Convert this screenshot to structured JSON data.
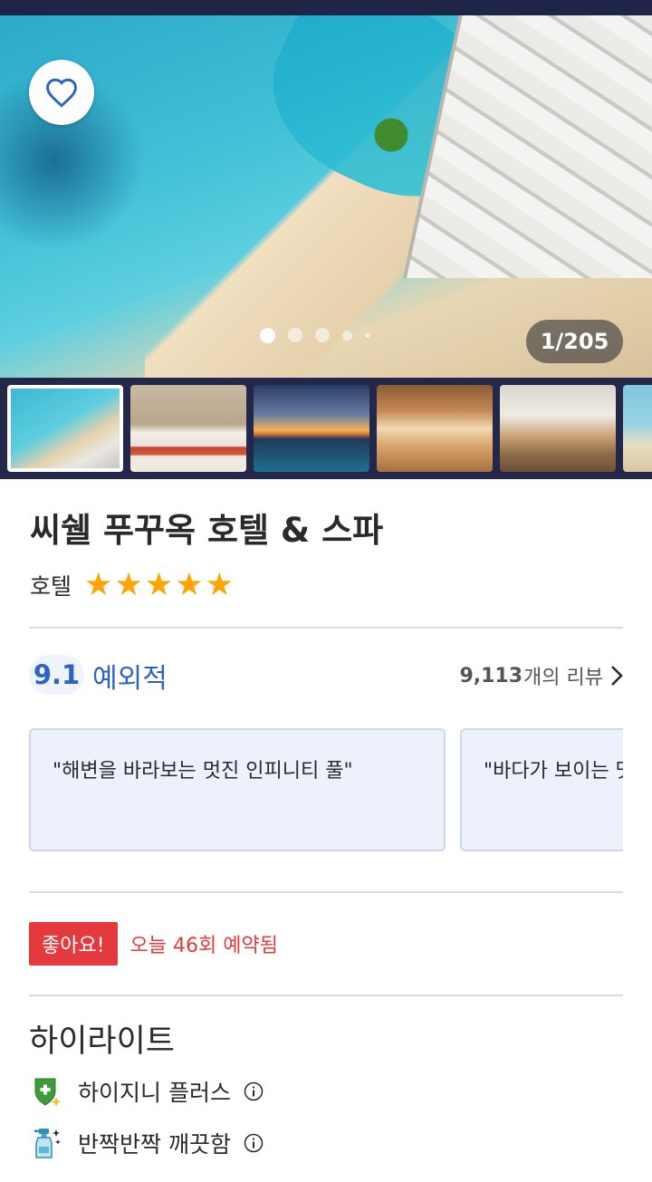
{
  "gallery": {
    "counter": "1/205",
    "dots_count": 5,
    "active_dot": 0,
    "thumbnails": [
      {
        "name": "thumb-beach-aerial",
        "selected": true
      },
      {
        "name": "thumb-room"
      },
      {
        "name": "thumb-infinity-pool-sunset"
      },
      {
        "name": "thumb-restaurant"
      },
      {
        "name": "thumb-lounge"
      },
      {
        "name": "thumb-beach"
      }
    ]
  },
  "hotel": {
    "name": "씨쉘 푸꾸옥 호텔 & 스파",
    "type": "호텔",
    "stars": 5
  },
  "rating": {
    "score": "9.1",
    "label": "예외적",
    "review_count": "9,113",
    "review_suffix": "개의 리뷰"
  },
  "review_quotes": [
    "\"해변을 바라보는 멋진 인피니티 풀\"",
    "\"바다가 보이는 멋진 전망\""
  ],
  "promo": {
    "badge": "좋아요!",
    "text": "오늘 46회 예약됨"
  },
  "highlights": {
    "title": "하이라이트",
    "items": [
      {
        "label": "하이지니 플러스",
        "icon": "shield-plus-icon"
      },
      {
        "label": "반짝반짝 깨끗함",
        "icon": "spray-bottle-icon"
      }
    ]
  },
  "colors": {
    "accent_blue": "#2d62c7",
    "star": "#ffa400",
    "promo_red": "#e4393d",
    "thumb_strip_bg": "#23284a"
  }
}
